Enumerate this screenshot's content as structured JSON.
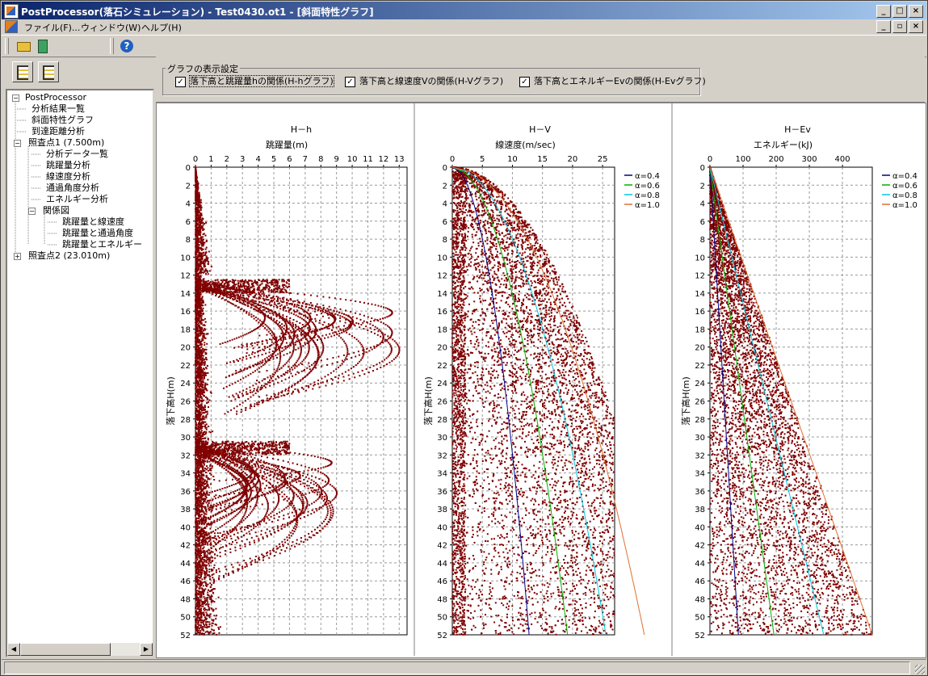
{
  "window": {
    "title": "PostProcessor(落石シミュレーション) - Test0430.ot1 - [斜面特性グラフ]",
    "minimize": "_",
    "maximize": "□",
    "close": "×"
  },
  "menu": {
    "items": [
      "ファイル(F)...",
      "ウィンドウ(W)",
      "ヘルプ(H)"
    ],
    "mdi": [
      "_",
      "▫",
      "×"
    ]
  },
  "toolbar": {
    "buttons": [
      "open-icon",
      "exit-icon",
      "help-icon"
    ]
  },
  "tree": {
    "root": "PostProcessor",
    "nodes": [
      {
        "label": "分析結果一覧",
        "level": 1
      },
      {
        "label": "斜面特性グラフ",
        "level": 1
      },
      {
        "label": "到達距離分析",
        "level": 1
      },
      {
        "label": "照査点1 (7.500m)",
        "level": 1,
        "expander": "−"
      },
      {
        "label": "分析データ一覧",
        "level": 2
      },
      {
        "label": "跳躍量分析",
        "level": 2
      },
      {
        "label": "線速度分析",
        "level": 2
      },
      {
        "label": "通過角度分析",
        "level": 2
      },
      {
        "label": "エネルギー分析",
        "level": 2
      },
      {
        "label": "関係図",
        "level": 2,
        "expander": "−"
      },
      {
        "label": "跳躍量と線速度",
        "level": 3
      },
      {
        "label": "跳躍量と通過角度",
        "level": 3
      },
      {
        "label": "跳躍量とエネルギー",
        "level": 3
      },
      {
        "label": "照査点2 (23.010m)",
        "level": 1,
        "expander": "+"
      }
    ]
  },
  "settings": {
    "group_label": "グラフの表示設定",
    "checkboxes": [
      {
        "label": "落下高と跳躍量hの関係(H-hグラフ)",
        "checked": true
      },
      {
        "label": "落下高と線速度Vの関係(H-Vグラフ)",
        "checked": true
      },
      {
        "label": "落下高とエネルギーEvの関係(H-Evグラフ)",
        "checked": true
      }
    ]
  },
  "chart_data": [
    {
      "type": "scatter",
      "title": "H－h",
      "xlabel": "跳躍量(m)",
      "ylabel": "落下高H(m)",
      "xticks": [
        0,
        1,
        2,
        3,
        4,
        5,
        6,
        7,
        8,
        9,
        10,
        11,
        12,
        13
      ],
      "xlim": [
        0,
        13.5
      ],
      "ylim": [
        0,
        52
      ],
      "yticks": [
        0,
        2,
        4,
        6,
        8,
        10,
        12,
        14,
        16,
        18,
        20,
        22,
        24,
        26,
        28,
        30,
        32,
        34,
        36,
        38,
        40,
        42,
        44,
        46,
        48,
        50,
        52
      ],
      "grid": true,
      "point_color": "#800000",
      "series": []
    },
    {
      "type": "scatter",
      "title": "H－V",
      "xlabel": "線速度(m/sec)",
      "ylabel": "落下高H(m)",
      "xticks": [
        0,
        5,
        10,
        15,
        20,
        25
      ],
      "xlim": [
        0,
        27
      ],
      "ylim": [
        0,
        52
      ],
      "yticks": [
        0,
        2,
        4,
        6,
        8,
        10,
        12,
        14,
        16,
        18,
        20,
        22,
        24,
        26,
        28,
        30,
        32,
        34,
        36,
        38,
        40,
        42,
        44,
        46,
        48,
        50,
        52
      ],
      "grid": true,
      "point_color": "#800000",
      "series": [
        {
          "name": "α=0.4",
          "color": "#00008b",
          "coef": 0.4
        },
        {
          "name": "α=0.6",
          "color": "#00b000",
          "coef": 0.6
        },
        {
          "name": "α=0.8",
          "color": "#00c8e0",
          "coef": 0.8
        },
        {
          "name": "α=1.0",
          "color": "#e07030",
          "coef": 1.0
        }
      ]
    },
    {
      "type": "scatter",
      "title": "H－Ev",
      "xlabel": "エネルギー(kJ)",
      "ylabel": "落下高H(m)",
      "xticks": [
        0,
        100,
        200,
        300,
        400
      ],
      "xlim": [
        0,
        490
      ],
      "ylim": [
        0,
        52
      ],
      "yticks": [
        0,
        2,
        4,
        6,
        8,
        10,
        12,
        14,
        16,
        18,
        20,
        22,
        24,
        26,
        28,
        30,
        32,
        34,
        36,
        38,
        40,
        42,
        44,
        46,
        48,
        50,
        52
      ],
      "grid": true,
      "point_color": "#800000",
      "series": [
        {
          "name": "α=0.4",
          "color": "#00008b",
          "coef": 0.4
        },
        {
          "name": "α=0.6",
          "color": "#00b000",
          "coef": 0.6
        },
        {
          "name": "α=0.8",
          "color": "#00c8e0",
          "coef": 0.8
        },
        {
          "name": "α=1.0",
          "color": "#e07030",
          "coef": 1.0
        }
      ]
    }
  ]
}
